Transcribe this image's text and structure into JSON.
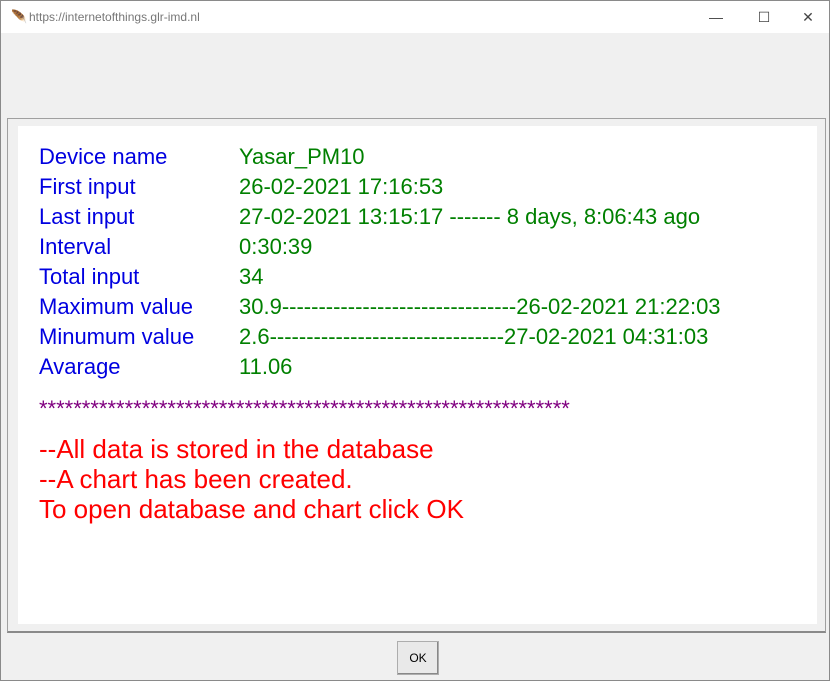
{
  "window": {
    "title": "https://internetofthings.glr-imd.nl",
    "icon": "feather-icon"
  },
  "info": [
    {
      "label": "Device name",
      "value": "Yasar_PM10"
    },
    {
      "label": "First input",
      "value": "26-02-2021 17:16:53"
    },
    {
      "label": "Last input",
      "value": "27-02-2021 13:15:17 ------- 8 days, 8:06:43 ago"
    },
    {
      "label": "Interval",
      "value": "0:30:39"
    },
    {
      "label": "Total input",
      "value": "34"
    },
    {
      "label": "Maximum value",
      "value": "30.9--------------------------------26-02-2021 21:22:03"
    },
    {
      "label": "Minumum value",
      "value": "2.6--------------------------------27-02-2021 04:31:03"
    },
    {
      "label": "Avarage",
      "value": "11.06"
    }
  ],
  "separator": "**************************************************************",
  "messages": [
    "--All data is stored in the database",
    "--A chart has been created.",
    "To open database and chart click OK"
  ],
  "ok_label": "OK",
  "colors": {
    "label": "#0000e0",
    "value": "#008000",
    "separator": "#800080",
    "message": "#ff0000"
  }
}
